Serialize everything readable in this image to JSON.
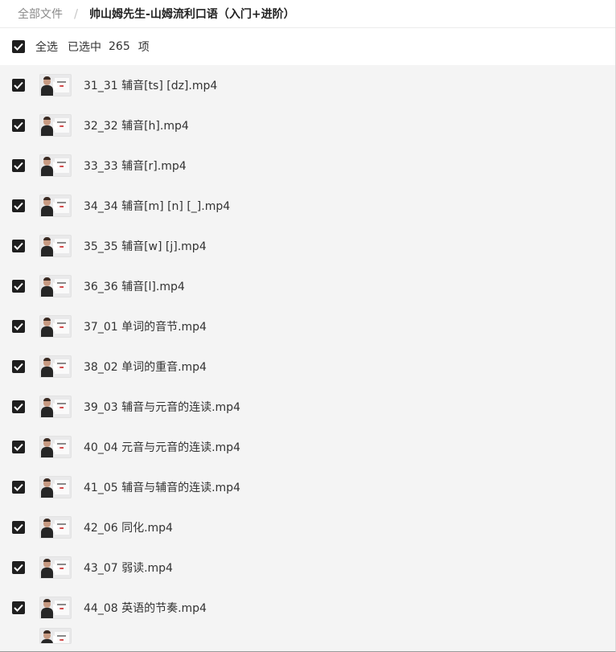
{
  "breadcrumb": {
    "root": "全部文件",
    "separator": "/",
    "current": "帅山姆先生-山姆流利口语（入门+进阶）"
  },
  "selection": {
    "select_all_label": "全选",
    "selected_prefix": "已选中",
    "selected_count": "265",
    "selected_suffix": "项",
    "all_checked": true
  },
  "files": [
    {
      "name": "31_31 辅音[ts] [dz].mp4",
      "checked": true
    },
    {
      "name": "32_32 辅音[h].mp4",
      "checked": true
    },
    {
      "name": "33_33 辅音[r].mp4",
      "checked": true
    },
    {
      "name": "34_34 辅音[m] [n] [_].mp4",
      "checked": true
    },
    {
      "name": "35_35 辅音[w] [j].mp4",
      "checked": true
    },
    {
      "name": "36_36 辅音[l].mp4",
      "checked": true
    },
    {
      "name": "37_01 单词的音节.mp4",
      "checked": true
    },
    {
      "name": "38_02 单词的重音.mp4",
      "checked": true
    },
    {
      "name": "39_03 辅音与元音的连读.mp4",
      "checked": true
    },
    {
      "name": "40_04 元音与元音的连读.mp4",
      "checked": true
    },
    {
      "name": "41_05 辅音与辅音的连读.mp4",
      "checked": true
    },
    {
      "name": "42_06 同化.mp4",
      "checked": true
    },
    {
      "name": "43_07 弱读.mp4",
      "checked": true
    },
    {
      "name": "44_08 英语的节奏.mp4",
      "checked": true
    }
  ],
  "icons": {
    "checkbox": "checkbox-checked-icon",
    "thumbnail": "video-thumbnail-icon",
    "play": "play-icon"
  },
  "colors": {
    "checkbox_fill": "#1f1f1f",
    "list_background": "#f4f4f4"
  }
}
